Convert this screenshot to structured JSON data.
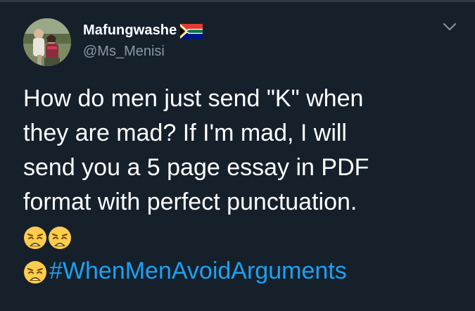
{
  "author": {
    "display_name": "Mafungwashe",
    "handle": "@Ms_Menisi",
    "flag_icon": "south-africa-flag-icon"
  },
  "menu": {
    "icon": "chevron-down-icon"
  },
  "tweet": {
    "lines": [
      "How do men just send \"K\" when",
      "they are mad? If I'm mad, I will",
      "send you a 5 page essay in PDF",
      "format with perfect punctuation."
    ],
    "emoji": "weary-face-icon",
    "hashtag": "#WhenMenAvoidArguments"
  },
  "colors": {
    "background": "#15202b",
    "text": "#ffffff",
    "secondary_text": "#8899a6",
    "link": "#1da1f2"
  }
}
